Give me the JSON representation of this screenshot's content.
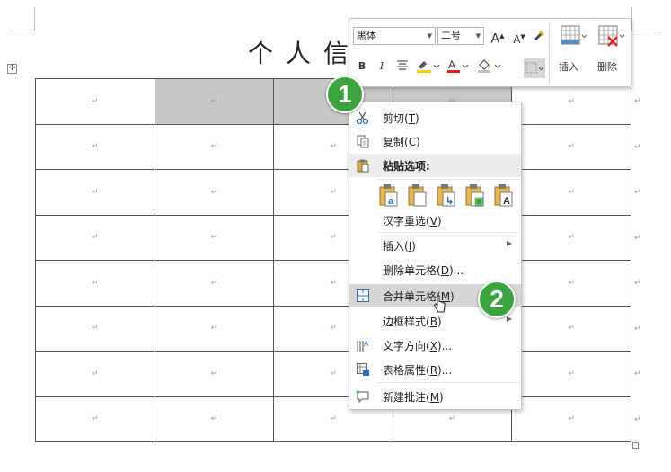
{
  "document": {
    "title": "个人信",
    "paragraph_mark": "↵",
    "move_handle_glyph": "✣"
  },
  "table": {
    "rows": 8,
    "columns": 5,
    "shaded_cells": [
      [
        0,
        1
      ],
      [
        0,
        2
      ],
      [
        0,
        3
      ]
    ]
  },
  "mini_toolbar": {
    "font_name": "黑体",
    "font_size": "二号",
    "grow_font": "A",
    "shrink_font": "A",
    "bold": "B",
    "italic": "I",
    "insert_label": "插入",
    "delete_label": "删除",
    "highlight_color": "#f5d400",
    "font_color": "#e02020"
  },
  "context_menu": {
    "items": [
      {
        "label": "剪切(",
        "key": "T",
        "icon": "scissors-icon"
      },
      {
        "label": "复制(",
        "key": "C",
        "icon": "copy-icon"
      },
      {
        "label": "粘贴选项:",
        "icon": "paste-icon"
      },
      {
        "label": "汉字重选(",
        "key": "V"
      },
      {
        "label": "插入(",
        "key": "I",
        "submenu": true
      },
      {
        "label": "删除单元格(",
        "key": "D",
        "suffix": "..."
      },
      {
        "label": "合并单元格(",
        "key": "M",
        "icon": "merge-cells-icon",
        "highlighted": true
      },
      {
        "label": "边框样式(",
        "key": "B",
        "submenu": true
      },
      {
        "label": "文字方向(",
        "key": "X",
        "suffix": "...",
        "icon": "text-direction-icon"
      },
      {
        "label": "表格属性(",
        "key": "R",
        "suffix": "...",
        "icon": "table-properties-icon"
      },
      {
        "label": "新建批注(",
        "key": "M",
        "icon": "new-comment-icon"
      }
    ],
    "close_paren": ")"
  },
  "badges": {
    "step1": "1",
    "step2": "2",
    "color": "#3aa53f"
  }
}
